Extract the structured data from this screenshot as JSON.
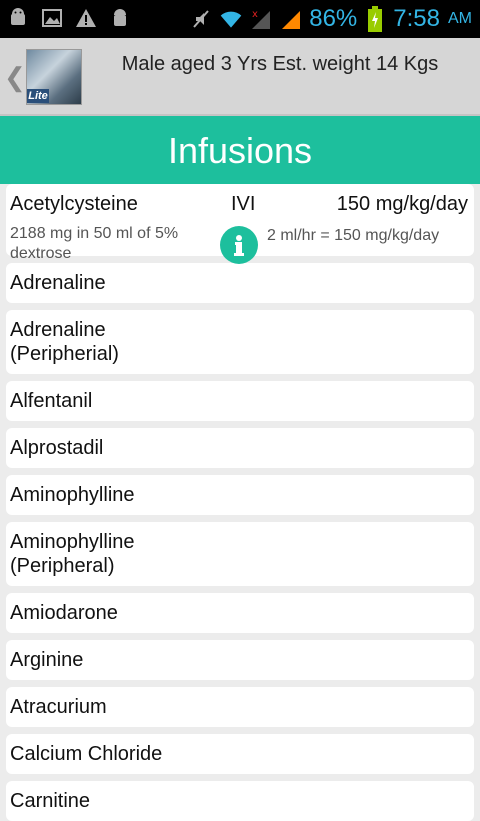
{
  "status_bar": {
    "battery_percent": "86%",
    "time": "7:58",
    "ampm": "AM",
    "icons": [
      "android-debug-icon",
      "image-icon",
      "warning-icon",
      "android-icon",
      "mute-icon",
      "wifi-icon",
      "signal-off-icon",
      "signal-icon",
      "battery-charging-icon"
    ],
    "accent_color": "#33b5e5"
  },
  "header": {
    "title": "Male aged 3 Yrs  Est. weight 14 Kgs",
    "badge": "Lite"
  },
  "banner": {
    "title": "Infusions",
    "color": "#1dbf9d"
  },
  "expanded": {
    "name": "Acetylcysteine",
    "route": "IVI",
    "dose": "150 mg/kg/day",
    "description": "2188 mg in 50 ml of 5% dextrose",
    "rate": "2 ml/hr = 150 mg/kg/day"
  },
  "items": [
    "Adrenaline",
    "Adrenaline (Peripherial)",
    "Alfentanil",
    "Alprostadil",
    "Aminophylline",
    "Aminophylline (Peripheral)",
    "Amiodarone",
    "Arginine",
    "Atracurium",
    "Calcium Chloride",
    "Carnitine"
  ]
}
